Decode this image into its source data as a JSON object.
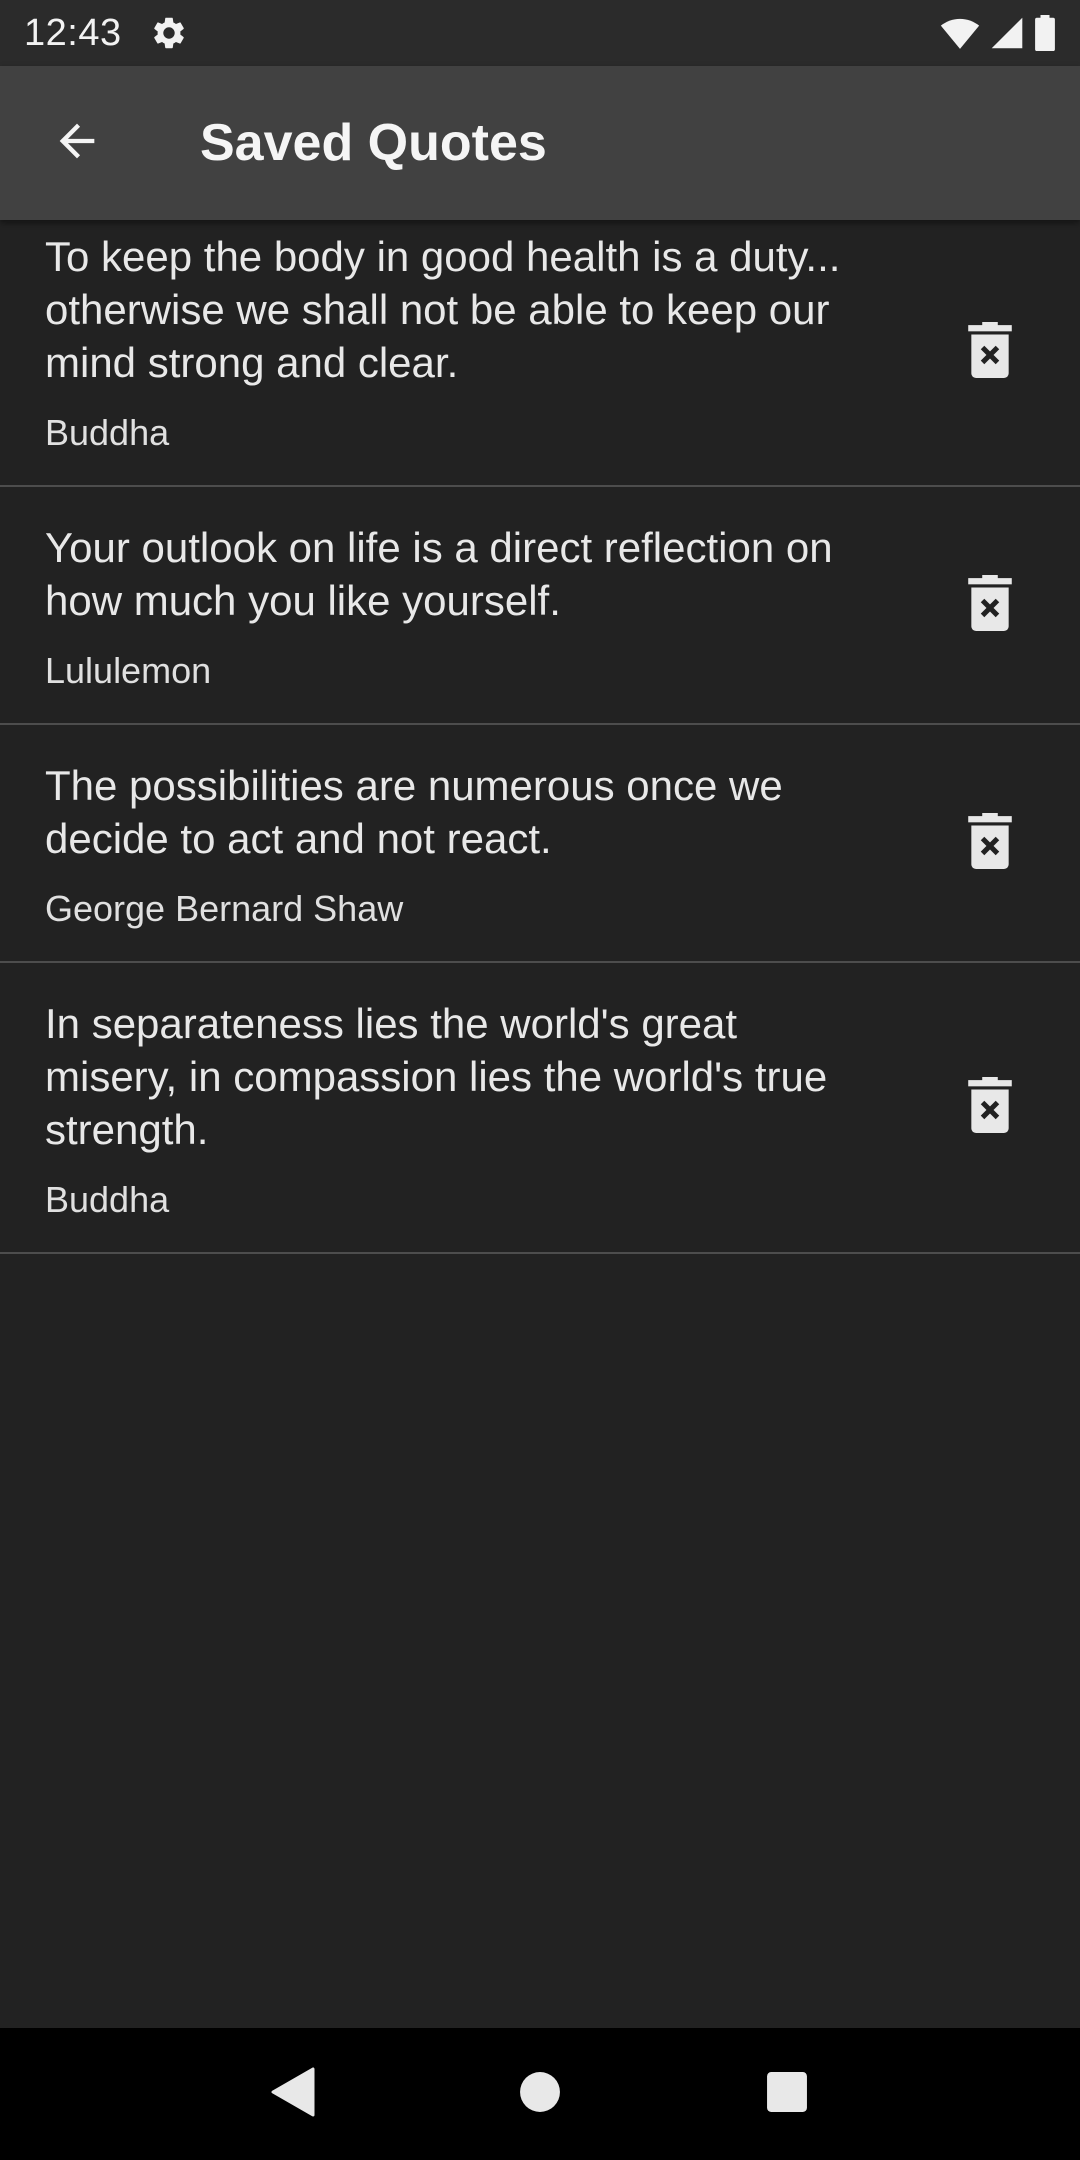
{
  "status_bar": {
    "time": "12:43",
    "icons": [
      "gear-icon",
      "wifi-icon",
      "signal-icon",
      "battery-icon"
    ]
  },
  "app_bar": {
    "title": "Saved Quotes",
    "back_icon": "arrow-left-icon"
  },
  "quotes": [
    {
      "text": "To keep the body in good health is a duty... otherwise we shall not be able to keep our mind strong and clear.",
      "author": "Buddha"
    },
    {
      "text": "Your outlook on life is a direct reflection on how much you like yourself.",
      "author": "Lululemon"
    },
    {
      "text": "The possibilities are numerous once we decide to act and not react.",
      "author": "George Bernard Shaw"
    },
    {
      "text": "In separateness lies the world's great misery, in compassion lies the world's true strength.",
      "author": "Buddha"
    }
  ],
  "item_action_icon": "delete-icon",
  "nav_bar": {
    "icons": [
      "back-triangle-icon",
      "home-circle-icon",
      "recents-square-icon"
    ]
  },
  "colors": {
    "background": "#222222",
    "app_bar": "#414141",
    "status_bar": "#2b2b2b",
    "divider": "#4d4d4d",
    "text": "#e8e8e8"
  }
}
